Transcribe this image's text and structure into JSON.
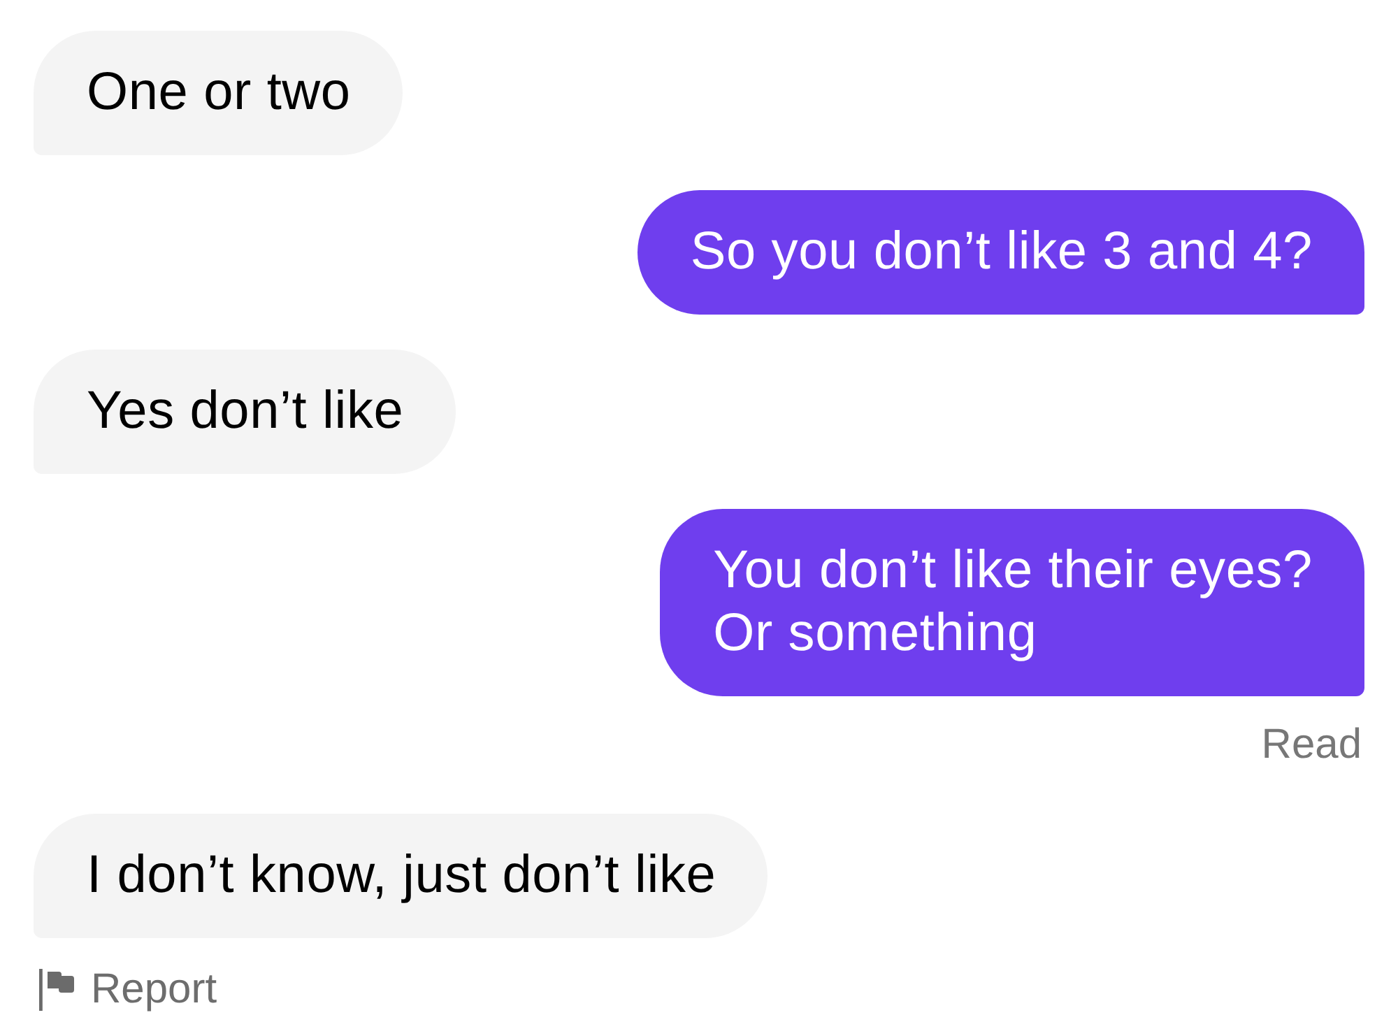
{
  "messages": [
    {
      "kind": "incoming",
      "text": "One or two"
    },
    {
      "kind": "outgoing",
      "text": "So you don’t like 3 and 4?"
    },
    {
      "kind": "incoming",
      "text": "Yes don’t like"
    },
    {
      "kind": "outgoing",
      "text": "You don’t like their eyes?\nOr something",
      "receipt": "Read"
    },
    {
      "kind": "incoming",
      "text": "I don’t know, just don’t like"
    }
  ],
  "report": {
    "label": "Report"
  }
}
